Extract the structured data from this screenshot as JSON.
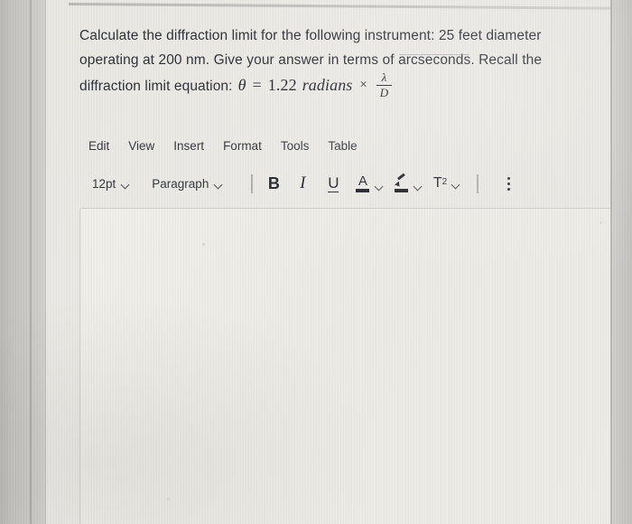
{
  "prompt": {
    "line1": "Calculate the diffraction limit for the following instrument: 25 feet diameter",
    "line2_a": "operating at 200 nm. Give your answer in terms of ",
    "line2_artifact": "arcseconds",
    "line2_b": ". Recall the",
    "line3": "diffraction limit equation:",
    "equation": {
      "theta": "θ",
      "equals": "=",
      "coefficient": "1.22",
      "unit": "radians",
      "times": "×",
      "numerator": "λ",
      "denominator": "D",
      "plain": "θ = 1.22 radians × λ/D"
    }
  },
  "editor": {
    "menu": [
      {
        "label": "Edit",
        "name": "menu-edit"
      },
      {
        "label": "View",
        "name": "menu-view"
      },
      {
        "label": "Insert",
        "name": "menu-insert"
      },
      {
        "label": "Format",
        "name": "menu-format"
      },
      {
        "label": "Tools",
        "name": "menu-tools"
      },
      {
        "label": "Table",
        "name": "menu-table"
      }
    ],
    "toolbar": {
      "font_size": "12pt",
      "block_format": "Paragraph",
      "bold": "B",
      "italic": "I",
      "underline": "U",
      "text_color_glyph": "A",
      "highlight_icon": "pen-icon",
      "superscript_base": "T",
      "superscript_exp": "2",
      "more_options": "⋮",
      "chevron": "chevron-down-icon"
    },
    "body_text": "",
    "body_placeholder": ""
  },
  "colors": {
    "page_background": "#eae8e3",
    "editor_background": "#eeece6",
    "text": "#2c3037",
    "border": "#cfcec9",
    "bezel": "#c5c4c0"
  }
}
